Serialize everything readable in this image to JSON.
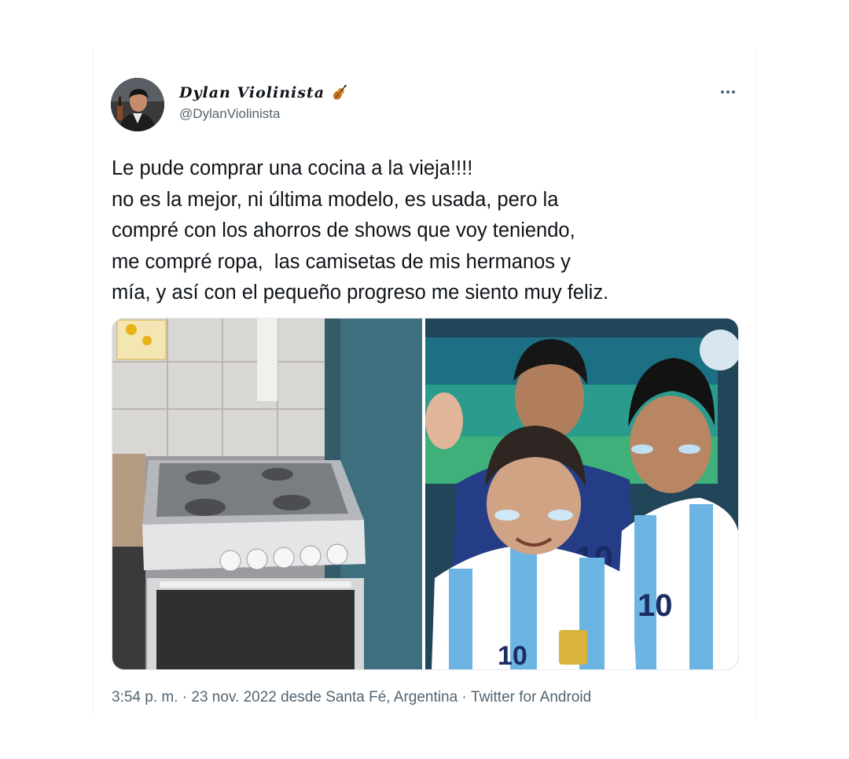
{
  "author": {
    "display_name": "Dylan Violinista",
    "handle": "@DylanViolinista"
  },
  "tweet": {
    "lines": [
      "Le pude comprar una cocina a la vieja!!!!",
      "no es la mejor, ni última modelo, es usada, pero la",
      "compré con los ahorros de shows que voy teniendo,",
      "me compré ropa,  las camisetas de mis hermanos y",
      "mía, y así con el pequeño progreso me siento muy feliz."
    ]
  },
  "media": {
    "photo_1": {
      "icon": "stove-photo"
    },
    "photo_2": {
      "icon": "boys-in-argentina-jerseys-photo",
      "jersey_numbers": [
        "10",
        "10",
        "10"
      ]
    }
  },
  "meta": {
    "time": "3:54 p. m.",
    "separator": " · ",
    "date": "23 nov. 2022",
    "location_prefix": " desde ",
    "location": "Santa Fé, Argentina",
    "separator2": " · ",
    "source": "Twitter for Android"
  },
  "colors": {
    "text_primary": "#0f1419",
    "text_secondary": "#536471",
    "jersey_sky_blue": "#6cb4e4"
  }
}
